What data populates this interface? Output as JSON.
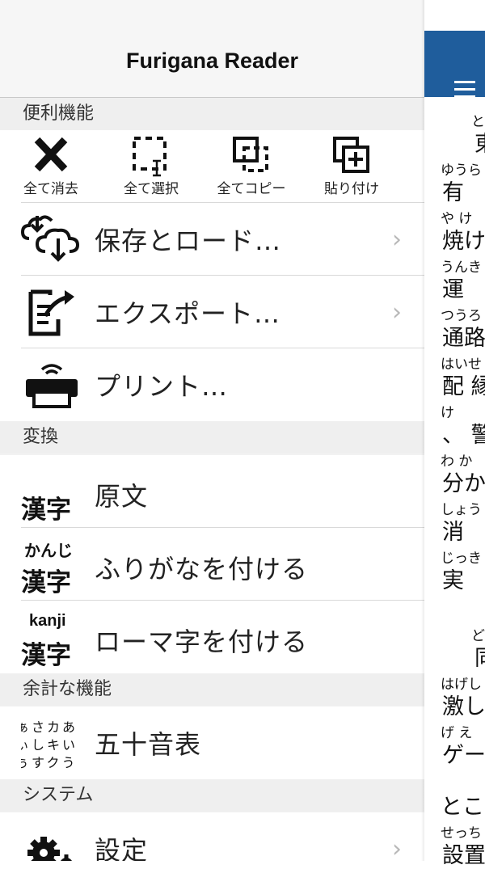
{
  "nav": {
    "title": "Furigana Reader"
  },
  "sections": {
    "convenience": "便利機能",
    "convert": "変換",
    "extra": "余計な機能",
    "system": "システム"
  },
  "toolbar": {
    "clear_label": "全て消去",
    "select_label": "全て選択",
    "copy_label": "全てコピー",
    "paste_label": "貼り付け"
  },
  "menu": {
    "save_load": "保存とロード…",
    "export": "エクスポート…",
    "print": "プリント…",
    "original": "原文",
    "furigana": "ふりがなを付ける",
    "romaji": "ローマ字を付ける",
    "gojuon": "五十音表",
    "settings": "設定"
  },
  "icons": {
    "kanji": "漢字",
    "kana": "かんじ",
    "romaji": "kanji",
    "gojuon_row1": "ぁさカあ",
    "gojuon_row2": "ぃしキい",
    "gojuon_row3": "ぅすクう"
  },
  "document_lines": [
    {
      "ruby": "と",
      "base": "東"
    },
    {
      "ruby": "ゆうら",
      "base": "有"
    },
    {
      "ruby": "や け",
      "base": "焼け"
    },
    {
      "ruby": "うんき",
      "base": "運"
    },
    {
      "ruby": "つうろ",
      "base": "通路"
    },
    {
      "ruby": "はいせ",
      "base": "配 縁"
    },
    {
      "ruby": "け",
      "base": "、 警"
    },
    {
      "ruby": "わ か",
      "base": "分か"
    },
    {
      "ruby": "しょう",
      "base": "消"
    },
    {
      "ruby": "じっき",
      "base": "実"
    },
    {
      "ruby": "ど",
      "base": "同"
    },
    {
      "ruby": "はげし",
      "base": "激し"
    },
    {
      "ruby": "げ え",
      "base": "ゲー"
    },
    {
      "ruby": "",
      "base": "とこ"
    },
    {
      "ruby": "せっち",
      "base": "設置"
    }
  ],
  "colors": {
    "accent_bar": "#1f5d9c",
    "section_bg": "#efefef",
    "chevron": "#b8b8b8"
  }
}
